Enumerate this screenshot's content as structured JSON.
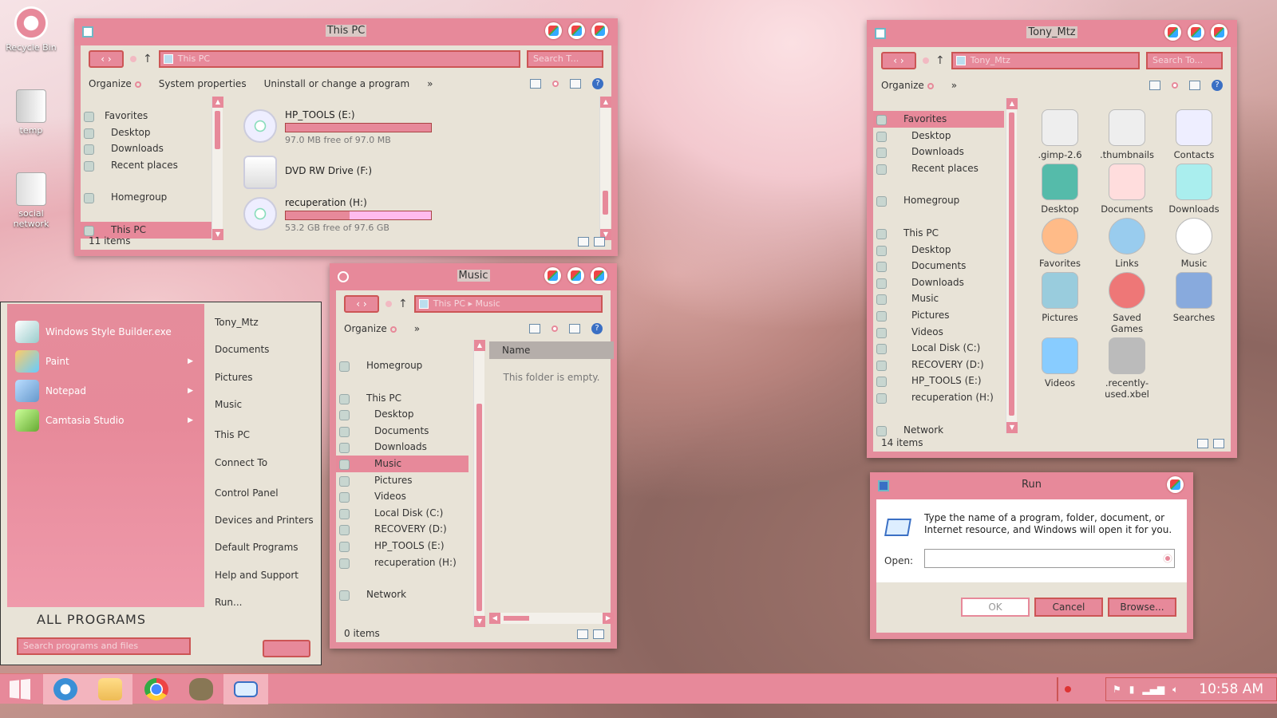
{
  "desktop": {
    "icons": [
      "Recycle Bin",
      "temp",
      "social network"
    ]
  },
  "thispc": {
    "title": "This PC",
    "address": "This PC",
    "search": "Search T...",
    "cmd": [
      "Organize",
      "System properties",
      "Uninstall or change a program",
      "»"
    ],
    "tree": [
      "Favorites",
      "Desktop",
      "Downloads",
      "Recent places",
      "Homegroup",
      "This PC"
    ],
    "drives": [
      {
        "name": "HP_TOOLS (E:)",
        "free": "97.0 MB free of 97.0 MB",
        "used_fraction": 0.999
      },
      {
        "name": "DVD RW Drive (F:)"
      },
      {
        "name": "recuperation (H:)",
        "free": "53.2 GB free of 97.6 GB",
        "used_fraction": 0.45
      }
    ],
    "status": "11 items"
  },
  "music": {
    "title": "Music",
    "address": [
      "This PC",
      "Music"
    ],
    "cmd": [
      "Organize",
      "»"
    ],
    "tree": [
      "Homegroup",
      "This PC",
      "Desktop",
      "Documents",
      "Downloads",
      "Music",
      "Pictures",
      "Videos",
      "Local Disk (C:)",
      "RECOVERY (D:)",
      "HP_TOOLS (E:)",
      "recuperation (H:)",
      "Network"
    ],
    "col": "Name",
    "empty": "This folder is empty.",
    "status": "0 items"
  },
  "tony": {
    "title": "Tony_Mtz",
    "address": "Tony_Mtz",
    "search": "Search To...",
    "cmd": [
      "Organize",
      "»"
    ],
    "tree": [
      "Favorites",
      "Desktop",
      "Downloads",
      "Recent places",
      "Homegroup",
      "This PC",
      "Desktop",
      "Documents",
      "Downloads",
      "Music",
      "Pictures",
      "Videos",
      "Local Disk (C:)",
      "RECOVERY (D:)",
      "HP_TOOLS (E:)",
      "recuperation (H:)",
      "Network"
    ],
    "items": [
      ".gimp-2.6",
      ".thumbnails",
      "Contacts",
      "Desktop",
      "Documents",
      "Downloads",
      "Favorites",
      "Links",
      "Music",
      "Pictures",
      "Saved Games",
      "Searches",
      "Videos",
      ".recently-used.xbel"
    ],
    "status": "14 items"
  },
  "run": {
    "title": "Run",
    "desc": "Type the name of a program, folder, document, or Internet resource, and Windows will open it for you.",
    "open_label": "Open:",
    "value": "",
    "ok": "OK",
    "cancel": "Cancel",
    "browse": "Browse..."
  },
  "start": {
    "programs": [
      "Windows Style Builder.exe",
      "Paint",
      "Notepad",
      "Camtasia Studio"
    ],
    "links": [
      "Tony_Mtz",
      "Documents",
      "Pictures",
      "Music",
      "This PC",
      "Connect To",
      "Control Panel",
      "Devices and Printers",
      "Default Programs",
      "Help and Support",
      "Run..."
    ],
    "all_programs": "ALL PROGRAMS",
    "search_placeholder": "Search programs and files"
  },
  "taskbar": {
    "clock": "10:58 AM"
  },
  "colors": {
    "accent": "#e7899a",
    "frame": "#e48d9c",
    "window_bg": "#e8e3d7"
  }
}
